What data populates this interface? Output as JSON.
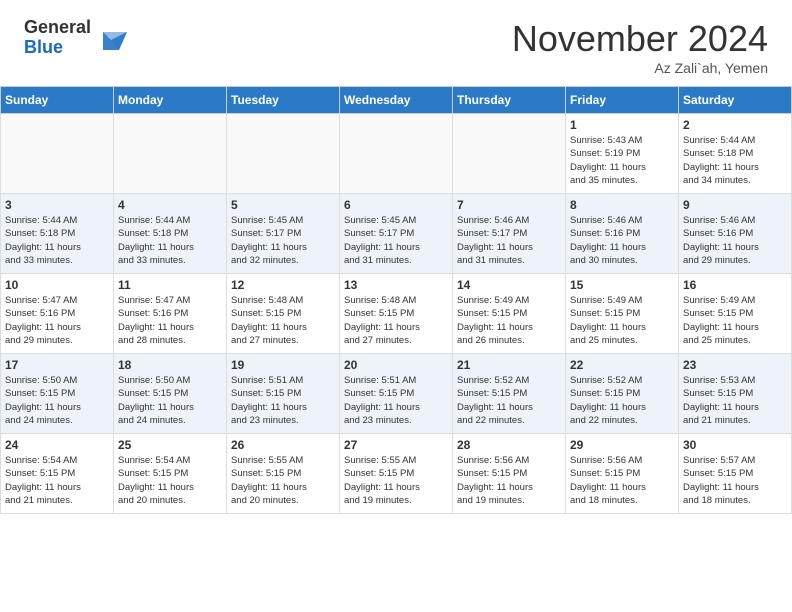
{
  "header": {
    "logo_general": "General",
    "logo_blue": "Blue",
    "month_title": "November 2024",
    "location": "Az Zali`ah, Yemen"
  },
  "days_of_week": [
    "Sunday",
    "Monday",
    "Tuesday",
    "Wednesday",
    "Thursday",
    "Friday",
    "Saturday"
  ],
  "weeks": [
    [
      {
        "day": "",
        "info": ""
      },
      {
        "day": "",
        "info": ""
      },
      {
        "day": "",
        "info": ""
      },
      {
        "day": "",
        "info": ""
      },
      {
        "day": "",
        "info": ""
      },
      {
        "day": "1",
        "info": "Sunrise: 5:43 AM\nSunset: 5:19 PM\nDaylight: 11 hours\nand 35 minutes."
      },
      {
        "day": "2",
        "info": "Sunrise: 5:44 AM\nSunset: 5:18 PM\nDaylight: 11 hours\nand 34 minutes."
      }
    ],
    [
      {
        "day": "3",
        "info": "Sunrise: 5:44 AM\nSunset: 5:18 PM\nDaylight: 11 hours\nand 33 minutes."
      },
      {
        "day": "4",
        "info": "Sunrise: 5:44 AM\nSunset: 5:18 PM\nDaylight: 11 hours\nand 33 minutes."
      },
      {
        "day": "5",
        "info": "Sunrise: 5:45 AM\nSunset: 5:17 PM\nDaylight: 11 hours\nand 32 minutes."
      },
      {
        "day": "6",
        "info": "Sunrise: 5:45 AM\nSunset: 5:17 PM\nDaylight: 11 hours\nand 31 minutes."
      },
      {
        "day": "7",
        "info": "Sunrise: 5:46 AM\nSunset: 5:17 PM\nDaylight: 11 hours\nand 31 minutes."
      },
      {
        "day": "8",
        "info": "Sunrise: 5:46 AM\nSunset: 5:16 PM\nDaylight: 11 hours\nand 30 minutes."
      },
      {
        "day": "9",
        "info": "Sunrise: 5:46 AM\nSunset: 5:16 PM\nDaylight: 11 hours\nand 29 minutes."
      }
    ],
    [
      {
        "day": "10",
        "info": "Sunrise: 5:47 AM\nSunset: 5:16 PM\nDaylight: 11 hours\nand 29 minutes."
      },
      {
        "day": "11",
        "info": "Sunrise: 5:47 AM\nSunset: 5:16 PM\nDaylight: 11 hours\nand 28 minutes."
      },
      {
        "day": "12",
        "info": "Sunrise: 5:48 AM\nSunset: 5:15 PM\nDaylight: 11 hours\nand 27 minutes."
      },
      {
        "day": "13",
        "info": "Sunrise: 5:48 AM\nSunset: 5:15 PM\nDaylight: 11 hours\nand 27 minutes."
      },
      {
        "day": "14",
        "info": "Sunrise: 5:49 AM\nSunset: 5:15 PM\nDaylight: 11 hours\nand 26 minutes."
      },
      {
        "day": "15",
        "info": "Sunrise: 5:49 AM\nSunset: 5:15 PM\nDaylight: 11 hours\nand 25 minutes."
      },
      {
        "day": "16",
        "info": "Sunrise: 5:49 AM\nSunset: 5:15 PM\nDaylight: 11 hours\nand 25 minutes."
      }
    ],
    [
      {
        "day": "17",
        "info": "Sunrise: 5:50 AM\nSunset: 5:15 PM\nDaylight: 11 hours\nand 24 minutes."
      },
      {
        "day": "18",
        "info": "Sunrise: 5:50 AM\nSunset: 5:15 PM\nDaylight: 11 hours\nand 24 minutes."
      },
      {
        "day": "19",
        "info": "Sunrise: 5:51 AM\nSunset: 5:15 PM\nDaylight: 11 hours\nand 23 minutes."
      },
      {
        "day": "20",
        "info": "Sunrise: 5:51 AM\nSunset: 5:15 PM\nDaylight: 11 hours\nand 23 minutes."
      },
      {
        "day": "21",
        "info": "Sunrise: 5:52 AM\nSunset: 5:15 PM\nDaylight: 11 hours\nand 22 minutes."
      },
      {
        "day": "22",
        "info": "Sunrise: 5:52 AM\nSunset: 5:15 PM\nDaylight: 11 hours\nand 22 minutes."
      },
      {
        "day": "23",
        "info": "Sunrise: 5:53 AM\nSunset: 5:15 PM\nDaylight: 11 hours\nand 21 minutes."
      }
    ],
    [
      {
        "day": "24",
        "info": "Sunrise: 5:54 AM\nSunset: 5:15 PM\nDaylight: 11 hours\nand 21 minutes."
      },
      {
        "day": "25",
        "info": "Sunrise: 5:54 AM\nSunset: 5:15 PM\nDaylight: 11 hours\nand 20 minutes."
      },
      {
        "day": "26",
        "info": "Sunrise: 5:55 AM\nSunset: 5:15 PM\nDaylight: 11 hours\nand 20 minutes."
      },
      {
        "day": "27",
        "info": "Sunrise: 5:55 AM\nSunset: 5:15 PM\nDaylight: 11 hours\nand 19 minutes."
      },
      {
        "day": "28",
        "info": "Sunrise: 5:56 AM\nSunset: 5:15 PM\nDaylight: 11 hours\nand 19 minutes."
      },
      {
        "day": "29",
        "info": "Sunrise: 5:56 AM\nSunset: 5:15 PM\nDaylight: 11 hours\nand 18 minutes."
      },
      {
        "day": "30",
        "info": "Sunrise: 5:57 AM\nSunset: 5:15 PM\nDaylight: 11 hours\nand 18 minutes."
      }
    ]
  ]
}
